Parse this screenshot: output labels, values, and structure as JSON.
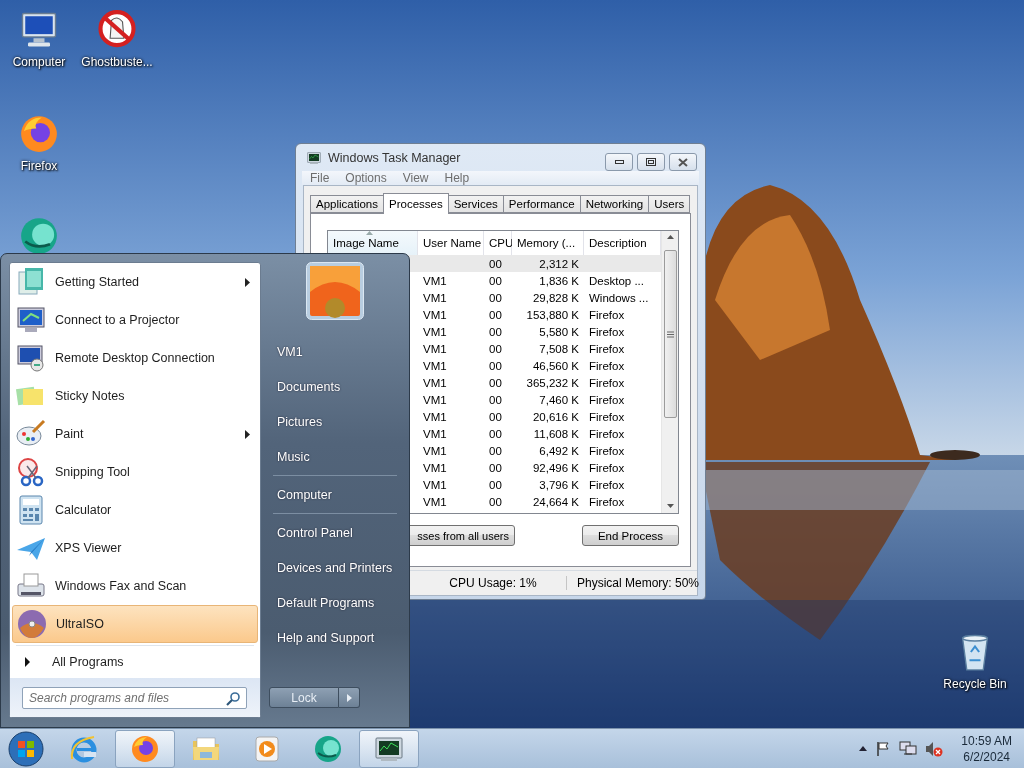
{
  "desktop_icons": [
    {
      "kind": "computer",
      "label": "Computer"
    },
    {
      "kind": "ghost",
      "label": "Ghostbuste..."
    },
    {
      "kind": "firefox",
      "label": "Firefox"
    },
    {
      "kind": "teal"
    },
    {
      "kind": "recycle",
      "label": "Recycle Bin"
    }
  ],
  "task_manager": {
    "title": "Windows Task Manager",
    "menu": [
      "File",
      "Options",
      "View",
      "Help"
    ],
    "tabs": [
      {
        "label": "Applications",
        "selected": false
      },
      {
        "label": "Processes",
        "selected": true
      },
      {
        "label": "Services",
        "selected": false
      },
      {
        "label": "Performance",
        "selected": false
      },
      {
        "label": "Networking",
        "selected": false
      },
      {
        "label": "Users",
        "selected": false
      }
    ],
    "columns": [
      {
        "label": "Image Name",
        "sorted": true
      },
      {
        "label": "User Name",
        "sorted": false
      },
      {
        "label": "CPU",
        "sorted": false
      },
      {
        "label": "Memory (...",
        "sorted": false
      },
      {
        "label": "Description",
        "sorted": false
      }
    ],
    "rows": [
      {
        "cpu": "00",
        "memory": "2,312 K",
        "selected": true
      },
      {
        "user": "VM1",
        "cpu": "00",
        "memory": "1,836 K",
        "description": "Desktop ...",
        "selected": false
      },
      {
        "user": "VM1",
        "cpu": "00",
        "memory": "29,828 K",
        "description": "Windows ...",
        "selected": false
      },
      {
        "user": "VM1",
        "cpu": "00",
        "memory": "153,880 K",
        "description": "Firefox",
        "selected": false
      },
      {
        "user": "VM1",
        "cpu": "00",
        "memory": "5,580 K",
        "description": "Firefox",
        "selected": false
      },
      {
        "user": "VM1",
        "cpu": "00",
        "memory": "7,508 K",
        "description": "Firefox",
        "selected": false
      },
      {
        "user": "VM1",
        "cpu": "00",
        "memory": "46,560 K",
        "description": "Firefox",
        "selected": false
      },
      {
        "user": "VM1",
        "cpu": "00",
        "memory": "365,232 K",
        "description": "Firefox",
        "selected": false
      },
      {
        "user": "VM1",
        "cpu": "00",
        "memory": "7,460 K",
        "description": "Firefox",
        "selected": false
      },
      {
        "user": "VM1",
        "cpu": "00",
        "memory": "20,616 K",
        "description": "Firefox",
        "selected": false
      },
      {
        "user": "VM1",
        "cpu": "00",
        "memory": "11,608 K",
        "description": "Firefox",
        "selected": false
      },
      {
        "user": "VM1",
        "cpu": "00",
        "memory": "6,492 K",
        "description": "Firefox",
        "selected": false
      },
      {
        "user": "VM1",
        "cpu": "00",
        "memory": "92,496 K",
        "description": "Firefox",
        "selected": false
      },
      {
        "user": "VM1",
        "cpu": "00",
        "memory": "3,796 K",
        "description": "Firefox",
        "selected": false
      },
      {
        "user": "VM1",
        "cpu": "00",
        "memory": "24,664 K",
        "description": "Firefox",
        "selected": false
      }
    ],
    "buttons": [
      "sses from all users",
      "End Process"
    ],
    "status_bar": [
      "CPU Usage: 1%",
      "Physical Memory: 50%"
    ]
  },
  "start_menu": {
    "programs": [
      {
        "kind": "getting-started",
        "label": "Getting Started",
        "submenu": true,
        "selected": false
      },
      {
        "kind": "projector",
        "label": "Connect to a Projector",
        "submenu": false,
        "selected": false
      },
      {
        "kind": "remote",
        "label": "Remote Desktop Connection",
        "submenu": false,
        "selected": false
      },
      {
        "kind": "notes",
        "label": "Sticky Notes",
        "submenu": false,
        "selected": false
      },
      {
        "kind": "paint",
        "label": "Paint",
        "submenu": true,
        "selected": false
      },
      {
        "kind": "snip",
        "label": "Snipping Tool",
        "submenu": false,
        "selected": false
      },
      {
        "kind": "calc",
        "label": "Calculator",
        "submenu": false,
        "selected": false
      },
      {
        "kind": "xps",
        "label": "XPS Viewer",
        "submenu": false,
        "selected": false
      },
      {
        "kind": "fax",
        "label": "Windows Fax and Scan",
        "submenu": false,
        "selected": false
      },
      {
        "kind": "disc",
        "label": "UltraISO",
        "submenu": false,
        "selected": true
      }
    ],
    "all_programs": "All Programs",
    "search": {
      "placeholder": "Search programs and files"
    },
    "places": [
      {
        "label": "VM1",
        "separator_before": false
      },
      {
        "label": "Documents",
        "separator_before": false
      },
      {
        "label": "Pictures",
        "separator_before": false
      },
      {
        "label": "Music",
        "separator_before": false
      },
      {
        "label": "Computer",
        "separator_before": true
      },
      {
        "label": "Control Panel",
        "separator_before": true
      },
      {
        "label": "Devices and Printers",
        "separator_before": false
      },
      {
        "label": "Default Programs",
        "separator_before": false
      },
      {
        "label": "Help and Support",
        "separator_before": false
      }
    ],
    "shutdown_button": "Lock"
  },
  "taskbar": {
    "buttons": [
      {
        "kind": "ie",
        "open": false
      },
      {
        "kind": "firefox",
        "open": true
      },
      {
        "kind": "folder",
        "open": false
      },
      {
        "kind": "media",
        "open": false
      },
      {
        "kind": "teal",
        "open": false
      },
      {
        "kind": "taskmgr",
        "open": true
      }
    ],
    "clock": {
      "time": "10:59 AM",
      "date": "6/2/2024"
    }
  }
}
